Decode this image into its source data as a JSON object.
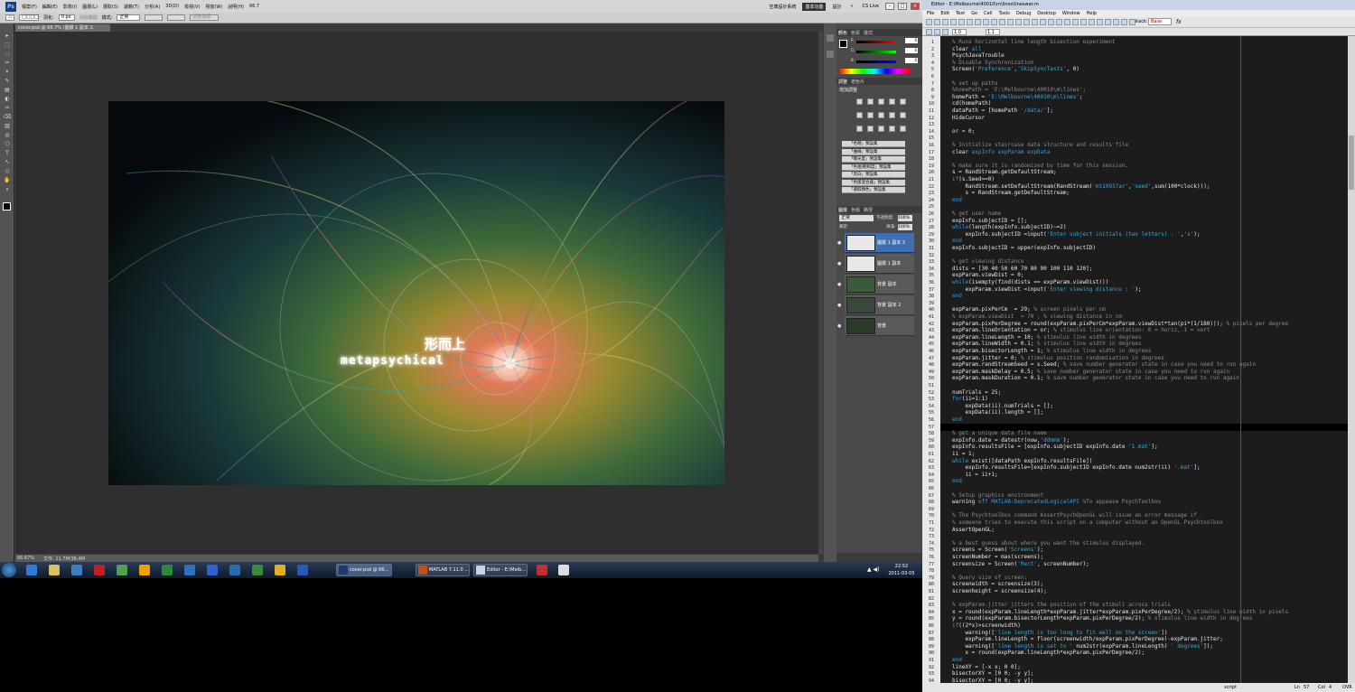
{
  "photoshop": {
    "menus": [
      "檔案(F)",
      "編輯(E)",
      "影像(I)",
      "圖層(L)",
      "選取(S)",
      "濾鏡(T)",
      "分析(A)",
      "3D(D)",
      "檢視(V)",
      "視窗(W)",
      "說明(H)"
    ],
    "zoom_menu": "66.7",
    "workspaces": [
      "空典設計系統",
      "基本功能",
      "設計"
    ],
    "cs_live": "CS Live",
    "options_bar": {
      "feather_label": "羽化:",
      "feather_value": "0 px",
      "antialias": "消除鋸齒",
      "style_label": "樣式:",
      "style_value": "正常",
      "refine": "調整邊緣..."
    },
    "doc_tab": "cover.psd @ 66.7% (圖層 1 副本 2, RGB/8)",
    "artwork": {
      "cjk_title": "形而上",
      "en_title": "metapsychical"
    },
    "status": {
      "zoom": "66.67%",
      "doc": "文件: 11.7M/36.4M"
    },
    "color_panel": {
      "tabs": [
        "顏色",
        "色票",
        "樣式"
      ],
      "r": "0",
      "g": "0",
      "b": "0"
    },
    "adjust_panel": {
      "tabs": [
        "調整",
        "遮色片"
      ],
      "title": "增加調整"
    },
    "presets": [
      "「色階」預設集",
      "「曲線」預設集",
      "「曝光度」預設集",
      "「色相/飽和度」預設集",
      "「黑白」預設集",
      "「色版混合器」預設集",
      "「選取顏色」預設集"
    ],
    "layers_panel": {
      "tabs": [
        "圖層",
        "色版",
        "路徑"
      ],
      "blend_mode": "正常",
      "opacity_label": "不透明度:",
      "opacity": "100%",
      "lock_label": "鎖定:",
      "fill_label": "填滿:",
      "fill": "100%",
      "layers": [
        "圖層 1 副本 2",
        "圖層 1 副本",
        "背景 副本",
        "背景 副本 2",
        "背景"
      ]
    }
  },
  "taskbar": {
    "tasks": [
      {
        "label": "cover.psd @ 66...",
        "active": true
      },
      {
        "label": "MATLAB 7.11.0 ...",
        "active": false
      },
      {
        "label": "Editor - E:\\Melb...",
        "active": false
      }
    ],
    "time": "22:52",
    "date": "2011-03-05"
  },
  "editor": {
    "title": "Editor - E:\\Melbourne\\40010\\m\\lines\\lineswar.m",
    "menus": [
      "File",
      "Edit",
      "Text",
      "Go",
      "Cell",
      "Tools",
      "Debug",
      "Desktop",
      "Window",
      "Help"
    ],
    "stack_label": "Stack:",
    "stack_value": "Base",
    "cell_values": [
      "1.0",
      "1.1"
    ],
    "status": {
      "mode": "script",
      "ln_label": "Ln",
      "ln": "57",
      "col_label": "Col",
      "col": "4",
      "ovr": "OVR"
    },
    "lines": [
      {
        "t": "% Runs horizontal line length bisection experiment",
        "c": "cm"
      },
      {
        "t": "clear all",
        "c": "mix",
        "s": [
          [
            "clear ",
            "tx"
          ],
          [
            "all",
            "kw"
          ]
        ]
      },
      {
        "t": "PsychJavaTrouble",
        "c": "tx"
      },
      {
        "t": "% Disable Synchronization",
        "c": "cm"
      },
      {
        "t": "Screen('Preference','SkipSyncTests', 0)",
        "c": "mix",
        "s": [
          [
            "Screen(",
            "tx"
          ],
          [
            "'Preference'",
            "st"
          ],
          [
            ",",
            "tx"
          ],
          [
            "'SkipSyncTests'",
            "st"
          ],
          [
            ", 0)",
            "tx"
          ]
        ]
      },
      {
        "t": "",
        "c": "tx"
      },
      {
        "t": "% set up paths",
        "c": "cm"
      },
      {
        "t": "%homePath = 'E:\\Melbourne\\40010\\m\\lines';",
        "c": "cm"
      },
      {
        "t": "homePath = 'E:\\Melbourne\\40010\\m\\lines';",
        "c": "mix",
        "s": [
          [
            "homePath = ",
            "tx"
          ],
          [
            "'E:\\Melbourne\\40010\\m\\lines'",
            "st"
          ],
          [
            ";",
            "tx"
          ]
        ]
      },
      {
        "t": "cd(homePath)",
        "c": "tx"
      },
      {
        "t": "dataPath = [homePath '/data/'];",
        "c": "mix",
        "s": [
          [
            "dataPath = [homePath ",
            "tx"
          ],
          [
            "'/data/'",
            "st"
          ],
          [
            "];",
            "tx"
          ]
        ]
      },
      {
        "t": "HideCursor",
        "c": "tx"
      },
      {
        "t": "",
        "c": "tx"
      },
      {
        "t": "or = 0;",
        "c": "tx"
      },
      {
        "t": "",
        "c": "tx"
      },
      {
        "t": "% Initialize staircase data structure and results file",
        "c": "cm"
      },
      {
        "t": "clear expInfo expParam expData",
        "c": "mix",
        "s": [
          [
            "clear ",
            "tx"
          ],
          [
            "expInfo expParam expData",
            "kw"
          ]
        ]
      },
      {
        "t": "",
        "c": "tx"
      },
      {
        "t": "% make sure it is randomized by time for this session.",
        "c": "cm"
      },
      {
        "t": "s = RandStream.getDefaultStream;",
        "c": "tx"
      },
      {
        "t": "if(s.Seed==0)",
        "c": "mix",
        "s": [
          [
            "if",
            "kw"
          ],
          [
            "(s.Seed==0)",
            "tx"
          ]
        ]
      },
      {
        "t": "    RandStream.setDefaultStream(RandStream('mt19937ar','seed',sum(100*clock)));",
        "c": "mix",
        "s": [
          [
            "    RandStream.setDefaultStream(RandStream(",
            "tx"
          ],
          [
            "'mt19937ar'",
            "st"
          ],
          [
            ",",
            "tx"
          ],
          [
            "'seed'",
            "st"
          ],
          [
            ",sum(100*clock)));",
            "tx"
          ]
        ]
      },
      {
        "t": "    s = RandStream.getDefaultStream;",
        "c": "tx"
      },
      {
        "t": "end",
        "c": "kw"
      },
      {
        "t": "",
        "c": "tx"
      },
      {
        "t": "% get user name",
        "c": "cm"
      },
      {
        "t": "expInfo.subjectID = [];",
        "c": "tx"
      },
      {
        "t": "while(length(expInfo.subjectID)~=2)",
        "c": "mix",
        "s": [
          [
            "while",
            "kw"
          ],
          [
            "(length(expInfo.subjectID)~=2)",
            "tx"
          ]
        ]
      },
      {
        "t": "    expInfo.subjectID =input('Enter subject initials (two letters) : ','s');",
        "c": "mix",
        "s": [
          [
            "    expInfo.subjectID =input(",
            "tx"
          ],
          [
            "'Enter subject initials (two letters) : '",
            "st"
          ],
          [
            ",",
            "tx"
          ],
          [
            "'s'",
            "st"
          ],
          [
            ");",
            "tx"
          ]
        ]
      },
      {
        "t": "end",
        "c": "kw"
      },
      {
        "t": "expInfo.subjectID = upper(expInfo.subjectID)",
        "c": "tx"
      },
      {
        "t": "",
        "c": "tx"
      },
      {
        "t": "% get viewing distance",
        "c": "cm"
      },
      {
        "t": "dists = [30 40 50 60 70 80 90 100 110 120];",
        "c": "tx"
      },
      {
        "t": "expParam.viewDist = 0;",
        "c": "tx"
      },
      {
        "t": "while(isempty(find(dists == expParam.viewDist)))",
        "c": "mix",
        "s": [
          [
            "while",
            "kw"
          ],
          [
            "(isempty(find(dists == expParam.viewDist)))",
            "tx"
          ]
        ]
      },
      {
        "t": "    expParam.viewDist =input('Enter viewing distance : ');",
        "c": "mix",
        "s": [
          [
            "    expParam.viewDist =input(",
            "tx"
          ],
          [
            "'Enter viewing distance : '",
            "st"
          ],
          [
            ");",
            "tx"
          ]
        ]
      },
      {
        "t": "end",
        "c": "kw"
      },
      {
        "t": "",
        "c": "tx"
      },
      {
        "t": "expParam.pixPerCm  = 29; % screen pixels per cm",
        "c": "mix",
        "s": [
          [
            "expParam.pixPerCm  = 29; ",
            "tx"
          ],
          [
            "% screen pixels per cm",
            "cm"
          ]
        ]
      },
      {
        "t": "% expParam.viewDist  = 70 ; % viewing distance in cm",
        "c": "cm"
      },
      {
        "t": "expParam.pixPerDegree = round(expParam.pixPerCm*expParam.viewDist*tan(pi*(1/180))); % pixels per degree",
        "c": "mix",
        "s": [
          [
            "expParam.pixPerDegree = round(expParam.pixPerCm*expParam.viewDist*tan(pi*(1/180))); ",
            "tx"
          ],
          [
            "% pixels per degree",
            "cm"
          ]
        ]
      },
      {
        "t": "expParam.lineOrientation = or; % stimulus line orientation: 0 = horiz, 1 = vert",
        "c": "mix",
        "s": [
          [
            "expParam.lineOrientation = or; ",
            "tx"
          ],
          [
            "% stimulus line orientation: 0 = horiz, 1 = vert",
            "cm"
          ]
        ]
      },
      {
        "t": "expParam.lineLength = 10; % stimulus line width in degrees",
        "c": "mix",
        "s": [
          [
            "expParam.lineLength = 10; ",
            "tx"
          ],
          [
            "% stimulus line width in degrees",
            "cm"
          ]
        ]
      },
      {
        "t": "expParam.lineWidth = 0.1; % stimulus line width in degrees",
        "c": "mix",
        "s": [
          [
            "expParam.lineWidth = 0.1; ",
            "tx"
          ],
          [
            "% stimulus line width in degrees",
            "cm"
          ]
        ]
      },
      {
        "t": "expParam.bisectorLength = 1; % stimulus line width in degrees",
        "c": "mix",
        "s": [
          [
            "expParam.bisectorLength = 1; ",
            "tx"
          ],
          [
            "% stimulus line width in degrees",
            "cm"
          ]
        ]
      },
      {
        "t": "expParam.jitter = 0; % stimulus position randomisation in degrees",
        "c": "mix",
        "s": [
          [
            "expParam.jitter = 0; ",
            "tx"
          ],
          [
            "% stimulus position randomisation in degrees",
            "cm"
          ]
        ]
      },
      {
        "t": "expParam.randStreamSeed = s.Seed; % save number generator state in case you need to run again",
        "c": "mix",
        "s": [
          [
            "expParam.randStreamSeed = s.Seed; ",
            "tx"
          ],
          [
            "% save number generator state in case you need to run again",
            "cm"
          ]
        ]
      },
      {
        "t": "expParam.maskDelay = 0.5; % save number generator state in case you need to run again",
        "c": "mix",
        "s": [
          [
            "expParam.maskDelay = 0.5; ",
            "tx"
          ],
          [
            "% save number generator state in case you need to run again",
            "cm"
          ]
        ]
      },
      {
        "t": "expParam.maskDuration = 0.1; % save number generator state in case you need to run again",
        "c": "mix",
        "s": [
          [
            "expParam.maskDuration = 0.1; ",
            "tx"
          ],
          [
            "% save number generator state in case you need to run again",
            "cm"
          ]
        ]
      },
      {
        "t": "",
        "c": "tx"
      },
      {
        "t": "numTrials = 25;",
        "c": "tx"
      },
      {
        "t": "for(ii=1:1)",
        "c": "mix",
        "s": [
          [
            "for",
            "kw"
          ],
          [
            "(ii=1:1)",
            "tx"
          ]
        ]
      },
      {
        "t": "    expData(ii).numTrials = [];",
        "c": "tx"
      },
      {
        "t": "    expData(ii).length = [];",
        "c": "tx"
      },
      {
        "t": "end",
        "c": "kw"
      },
      {
        "t": "",
        "c": "tx"
      },
      {
        "t": "% get a unique data file name",
        "c": "cm"
      },
      {
        "t": "expInfo.date = datestr(now,'ddmmm');",
        "c": "mix",
        "s": [
          [
            "expInfo.date = datestr(now,",
            "tx"
          ],
          [
            "'ddmmm'",
            "st"
          ],
          [
            ");",
            "tx"
          ]
        ]
      },
      {
        "t": "expInfo.resultsFile = [expInfo.subjectID expInfo.date '1.mat'];",
        "c": "mix",
        "s": [
          [
            "expInfo.resultsFile = [expInfo.subjectID expInfo.date ",
            "tx"
          ],
          [
            "'1.mat'",
            "st"
          ],
          [
            "];",
            "tx"
          ]
        ]
      },
      {
        "t": "ii = 1;",
        "c": "tx"
      },
      {
        "t": "while exist([dataPath expInfo.resultsFile])",
        "c": "mix",
        "s": [
          [
            "while",
            "kw"
          ],
          [
            " exist([dataPath expInfo.resultsFile])",
            "tx"
          ]
        ]
      },
      {
        "t": "    expInfo.resultsFile=[expInfo.subjectID expInfo.date num2str(ii) '.mat'];",
        "c": "mix",
        "s": [
          [
            "    expInfo.resultsFile=[expInfo.subjectID expInfo.date num2str(ii) ",
            "tx"
          ],
          [
            "'.mat'",
            "st"
          ],
          [
            "];",
            "tx"
          ]
        ]
      },
      {
        "t": "    ii = ii+1;",
        "c": "tx"
      },
      {
        "t": "end",
        "c": "kw"
      },
      {
        "t": "",
        "c": "tx"
      },
      {
        "t": "% Setup graphics environment",
        "c": "cm"
      },
      {
        "t": "warning off MATLAB:DeprecatedLogicalAPI %To appease PsychToolbox",
        "c": "mix",
        "s": [
          [
            "warning ",
            "tx"
          ],
          [
            "off MATLAB:DeprecatedLogicalAPI",
            "kw"
          ],
          [
            " %To appease PsychToolbox",
            "cm"
          ]
        ]
      },
      {
        "t": "",
        "c": "tx"
      },
      {
        "t": "% The Psychtoolbox command AssertPsychOpenGL will issue an error message if",
        "c": "cm"
      },
      {
        "t": "% someone tries to execute this script on a computer without an OpenGL Psychtoolbox",
        "c": "cm"
      },
      {
        "t": "AssertOpenGL;",
        "c": "tx"
      },
      {
        "t": "",
        "c": "tx"
      },
      {
        "t": "% a best guess about where you want the stimulus displayed.",
        "c": "cm"
      },
      {
        "t": "screens = Screen('Screens');",
        "c": "mix",
        "s": [
          [
            "screens = Screen(",
            "tx"
          ],
          [
            "'Screens'",
            "st"
          ],
          [
            ");",
            "tx"
          ]
        ]
      },
      {
        "t": "screenNumber = max(screens);",
        "c": "tx"
      },
      {
        "t": "screensize = Screen('Rect', screenNumber);",
        "c": "mix",
        "s": [
          [
            "screensize = Screen(",
            "tx"
          ],
          [
            "'Rect'",
            "st"
          ],
          [
            ", screenNumber);",
            "tx"
          ]
        ]
      },
      {
        "t": "",
        "c": "tx"
      },
      {
        "t": "% Query size of screen:",
        "c": "cm"
      },
      {
        "t": "screenwidth = screensize(3);",
        "c": "tx"
      },
      {
        "t": "screenheight = screensize(4);",
        "c": "tx"
      },
      {
        "t": "",
        "c": "tx"
      },
      {
        "t": "% expParam.jitter jitters the position of the stimuli across trials",
        "c": "cm"
      },
      {
        "t": "x = round(expParam.lineLength*expParam.jitter*expParam.pixPerDegree/2); % stimulus line width in pixels",
        "c": "mix",
        "s": [
          [
            "x = round(expParam.lineLength*expParam.jitter*expParam.pixPerDegree/2); ",
            "tx"
          ],
          [
            "% stimulus line width in pixels",
            "cm"
          ]
        ]
      },
      {
        "t": "y = round(expParam.bisectorLength*expParam.pixPerDegree/2); % stimulus line width in degrees",
        "c": "mix",
        "s": [
          [
            "y = round(expParam.bisectorLength*expParam.pixPerDegree/2); ",
            "tx"
          ],
          [
            "% stimulus line width in degrees",
            "cm"
          ]
        ]
      },
      {
        "t": "if((2*x)>screenwidth)",
        "c": "mix",
        "s": [
          [
            "if",
            "kw"
          ],
          [
            "((2*x)>screenwidth)",
            "tx"
          ]
        ]
      },
      {
        "t": "    warning(['line length is too long to fit well on the screen'])",
        "c": "mix",
        "s": [
          [
            "    warning([",
            "tx"
          ],
          [
            "'line length is too long to fit well on the screen'",
            "st"
          ],
          [
            "])",
            "tx"
          ]
        ]
      },
      {
        "t": "    expParam.lineLength = floor(screenwidth/expParam.pixPerDegree)-expParam.jitter;",
        "c": "tx"
      },
      {
        "t": "    warning(['line length is set to ' num2str(expParam.lineLength) ' degrees']);",
        "c": "mix",
        "s": [
          [
            "    warning([",
            "tx"
          ],
          [
            "'line length is set to '",
            "st"
          ],
          [
            " num2str(expParam.lineLength) ",
            "tx"
          ],
          [
            "' degrees'",
            "st"
          ],
          [
            "]);",
            "tx"
          ]
        ]
      },
      {
        "t": "    x = round(expParam.lineLength*expParam.pixPerDegree/2);",
        "c": "tx"
      },
      {
        "t": "end",
        "c": "kw"
      },
      {
        "t": "lineXY = [-x x; 0 0];",
        "c": "tx"
      },
      {
        "t": "bisectorXY = [0 0; -y y];",
        "c": "tx"
      },
      {
        "t": "bisectorXY = [0 0; -y y];",
        "c": "tx"
      }
    ]
  },
  "colors": {
    "comment": "#8a8a8a",
    "keyword": "#3c9ad8",
    "string": "#3aa7d6",
    "text": "#e8e8e8",
    "current_line": "#000000"
  }
}
